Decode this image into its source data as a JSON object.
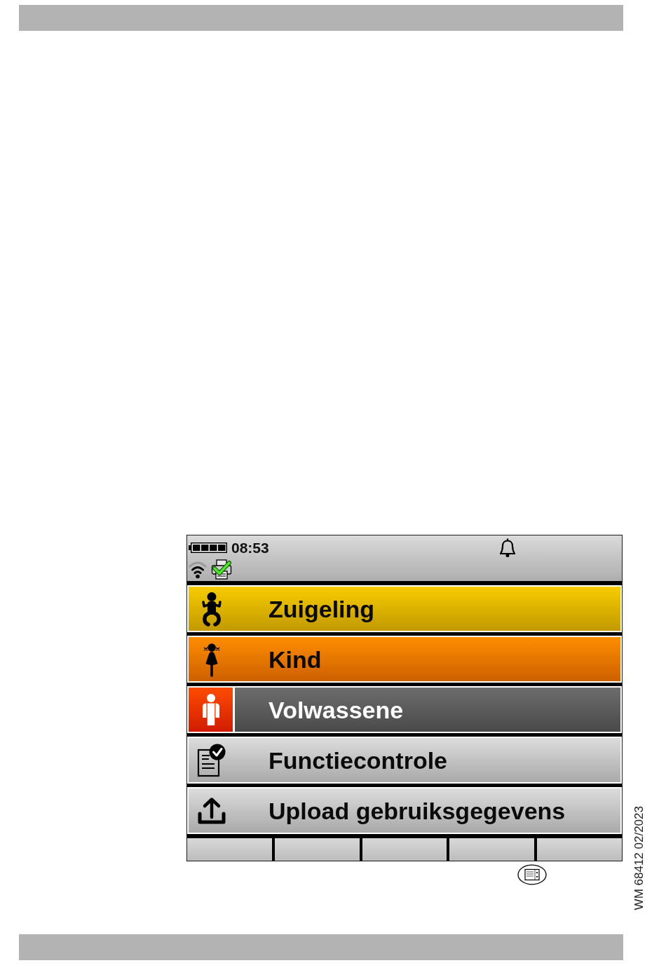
{
  "status_bar": {
    "time": "08:53"
  },
  "menu_items": [
    {
      "kind": "infant",
      "label": "Zuigeling",
      "selected": false
    },
    {
      "kind": "child",
      "label": "Kind",
      "selected": false
    },
    {
      "kind": "adult",
      "label": "Volwassene",
      "selected": true
    },
    {
      "kind": "check",
      "label": "Functiecontrole",
      "selected": false
    },
    {
      "kind": "upload",
      "label": "Upload gebruiksgegevens",
      "selected": false
    }
  ],
  "document_code": "WM 68412 02/2023"
}
